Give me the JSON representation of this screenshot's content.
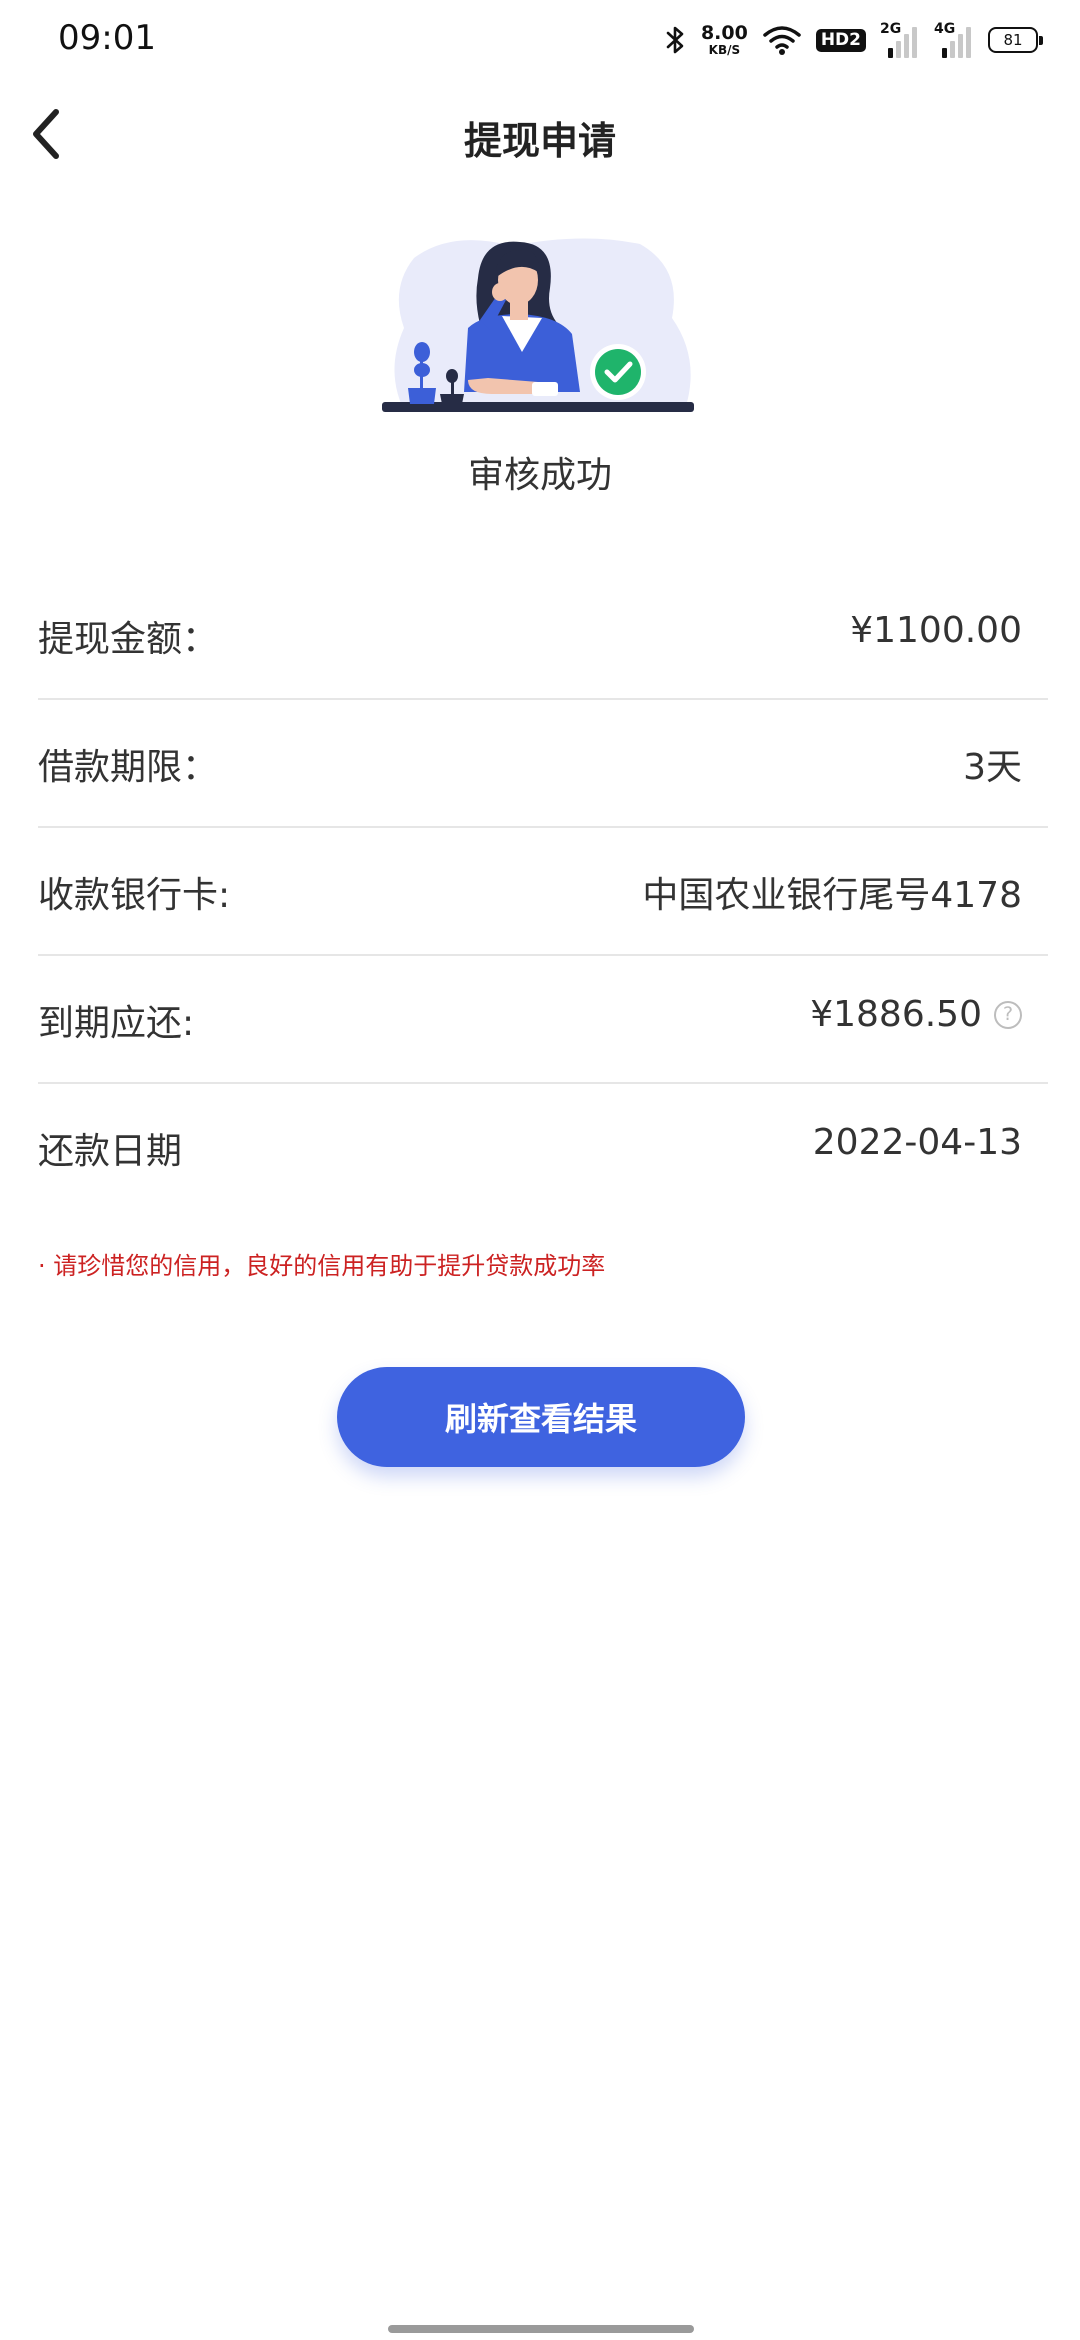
{
  "status_bar": {
    "time": "09:01",
    "net_speed_value": "8.00",
    "net_speed_unit": "KB/S",
    "hd_label": "HD2",
    "signal_2g_label": "2G",
    "signal_4g_label": "4G",
    "battery_level": "81"
  },
  "nav": {
    "title": "提现申请"
  },
  "status": {
    "title": "审核成功"
  },
  "rows": [
    {
      "label": "提现金额：",
      "value": "¥1100.00"
    },
    {
      "label": "借款期限：",
      "value": "3天"
    },
    {
      "label": "收款银行卡:",
      "value": "中国农业银行尾号4178"
    },
    {
      "label": "到期应还:",
      "value": "¥1886.50",
      "help": "?"
    },
    {
      "label": "还款日期",
      "value": "2022-04-13"
    }
  ],
  "credit_note": "· 请珍惜您的信用，良好的信用有助于提升贷款成功率",
  "refresh_button_label": "刷新查看结果",
  "colors": {
    "accent": "#3f63e0",
    "warning": "#cc2222",
    "success": "#1fb46b"
  }
}
